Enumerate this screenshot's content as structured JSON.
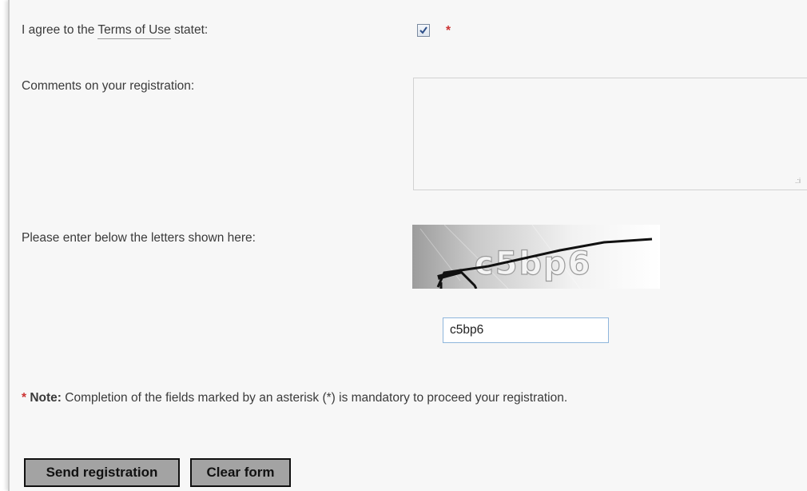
{
  "terms": {
    "prefix": "I agree to the ",
    "link": "Terms of Use",
    "suffix": " statet:",
    "checked": true,
    "required_mark": "*"
  },
  "comments": {
    "label": "Comments on your registration:",
    "value": ""
  },
  "captcha": {
    "label": "Please enter below the letters shown here:",
    "image_text": "c5bp6",
    "input_value": "c5bp6"
  },
  "note": {
    "asterisk": "*",
    "bold": "Note:",
    "text": " Completion of the fields marked by an asterisk (*) is mandatory to proceed your registration."
  },
  "buttons": {
    "send": "Send registration",
    "clear": "Clear form"
  },
  "colors": {
    "required": "#cc3333",
    "button_bg": "#a3a3a3",
    "panel_bg": "#f7f7f7",
    "input_border": "#8fb6dc"
  }
}
